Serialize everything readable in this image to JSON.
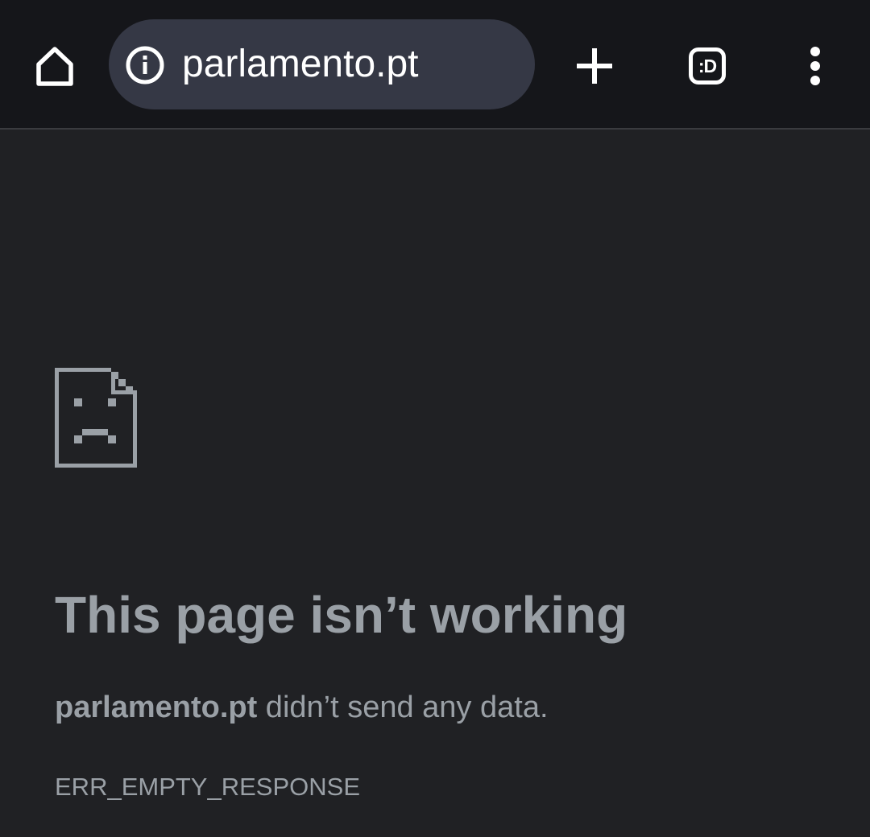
{
  "toolbar": {
    "home_icon": "home-icon",
    "site_info_icon": "info-icon",
    "url": "parlamento.pt",
    "new_tab_icon": "plus-icon",
    "tab_switcher_label": ":D",
    "menu_icon": "more-vertical-icon"
  },
  "error": {
    "icon": "sad-page-icon",
    "title": "This page isn’t working",
    "host": "parlamento.pt",
    "message": " didn’t send any data.",
    "code": "ERR_EMPTY_RESPONSE"
  },
  "colors": {
    "toolbar_bg": "#15161a",
    "omnibox_bg": "#353845",
    "page_bg": "#202124",
    "text_secondary": "#9aa0a6"
  }
}
